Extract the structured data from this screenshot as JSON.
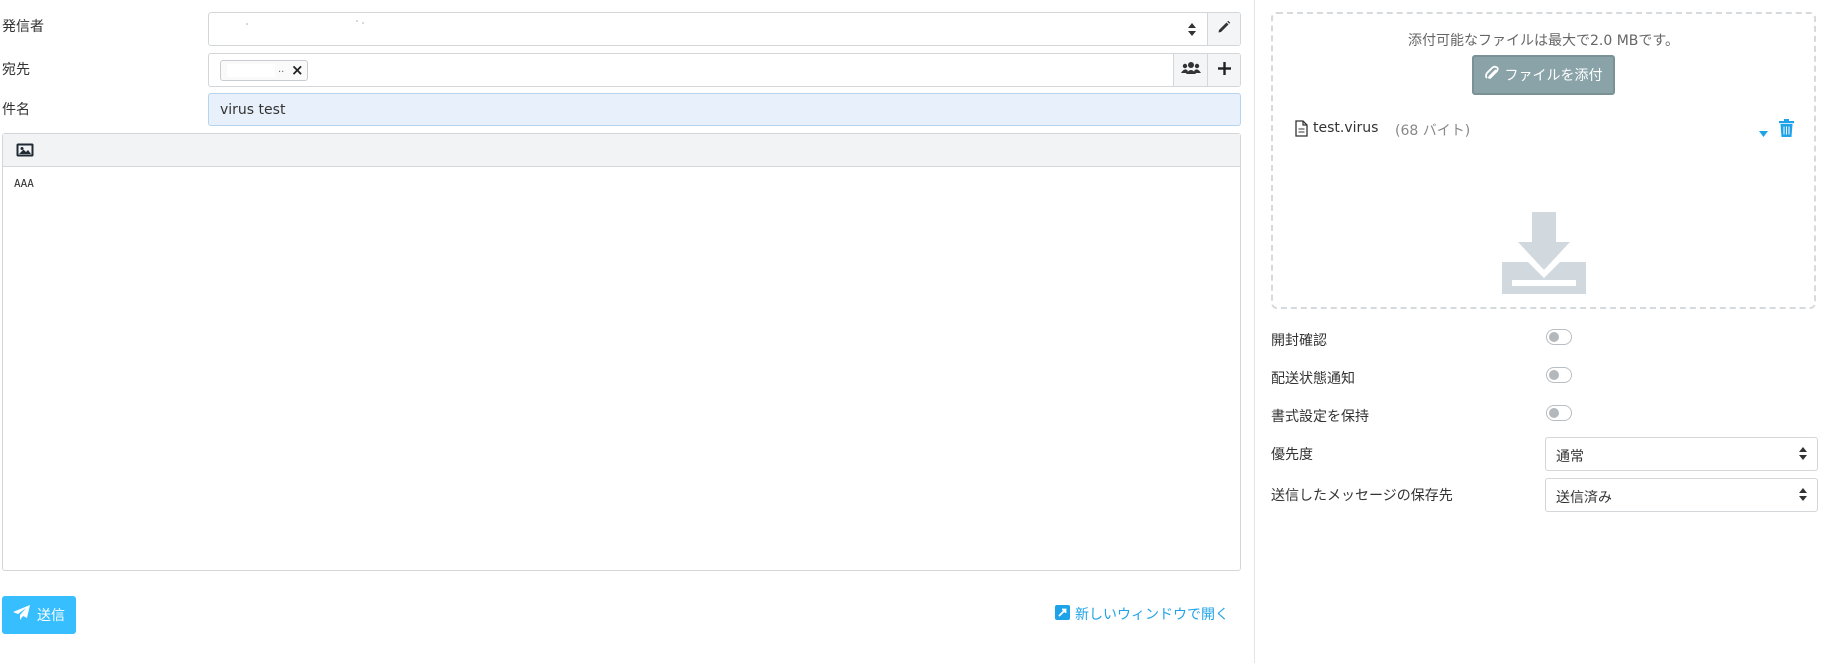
{
  "form": {
    "from_label": "発信者",
    "to_label": "宛先",
    "subject_label": "件名",
    "subject_value": "virus test",
    "body_text": "AAA"
  },
  "actions": {
    "send_label": "送信",
    "new_window_label": "新しいウィンドウで開く"
  },
  "attachments": {
    "limit_text": "添付可能なファイルは最大で2.0 MBです。",
    "attach_button_label": "ファイルを添付",
    "files": [
      {
        "name": "test.virus",
        "size": "(68 バイト)"
      }
    ]
  },
  "options": {
    "read_receipt_label": "開封確認",
    "dsn_label": "配送状態通知",
    "keep_formatting_label": "書式設定を保持",
    "priority_label": "優先度",
    "priority_value": "通常",
    "save_sent_label": "送信したメッセージの保存先",
    "save_sent_value": "送信済み"
  },
  "colors": {
    "accent": "#37beff",
    "link": "#1fa3e8",
    "attach_button": "#8aa3a8"
  }
}
